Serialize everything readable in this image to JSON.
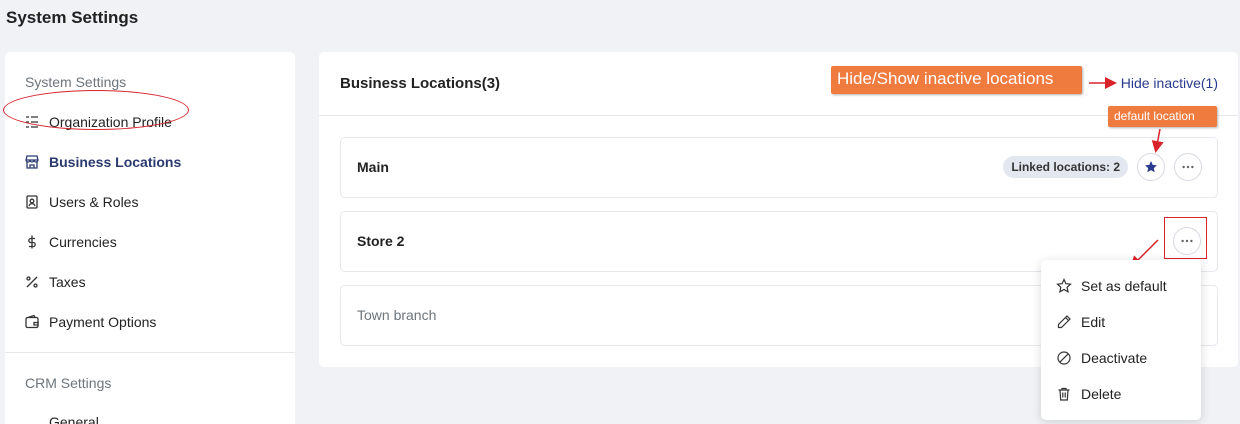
{
  "page": {
    "title": "System Settings"
  },
  "sidebar": {
    "section1": "System Settings",
    "items": [
      {
        "label": "Organization Profile",
        "icon": "list-indent-icon"
      },
      {
        "label": "Business Locations",
        "icon": "store-icon"
      },
      {
        "label": "Users & Roles",
        "icon": "user-doc-icon"
      },
      {
        "label": "Currencies",
        "icon": "dollar-icon"
      },
      {
        "label": "Taxes",
        "icon": "percent-icon"
      },
      {
        "label": "Payment Options",
        "icon": "wallet-icon"
      }
    ],
    "section2": "CRM Settings",
    "items2": [
      {
        "label": "General"
      }
    ]
  },
  "main": {
    "title": "Business Locations(3)",
    "hide_link": "Hide inactive(1)",
    "locations": [
      {
        "name": "Main",
        "badge": "Linked locations: 2",
        "is_default": true
      },
      {
        "name": "Store 2"
      },
      {
        "name": "Town branch",
        "inactive": true
      }
    ]
  },
  "annotations": {
    "hide_show": "Hide/Show inactive locations",
    "default_location": "default location"
  },
  "dropdown": {
    "items": [
      {
        "label": "Set as default",
        "icon": "star-outline-icon"
      },
      {
        "label": "Edit",
        "icon": "pencil-icon"
      },
      {
        "label": "Deactivate",
        "icon": "ban-icon"
      },
      {
        "label": "Delete",
        "icon": "trash-icon"
      }
    ]
  },
  "colors": {
    "accent": "#2a3a8e",
    "annotation": "#f07b3f",
    "highlight": "#d8232a"
  }
}
